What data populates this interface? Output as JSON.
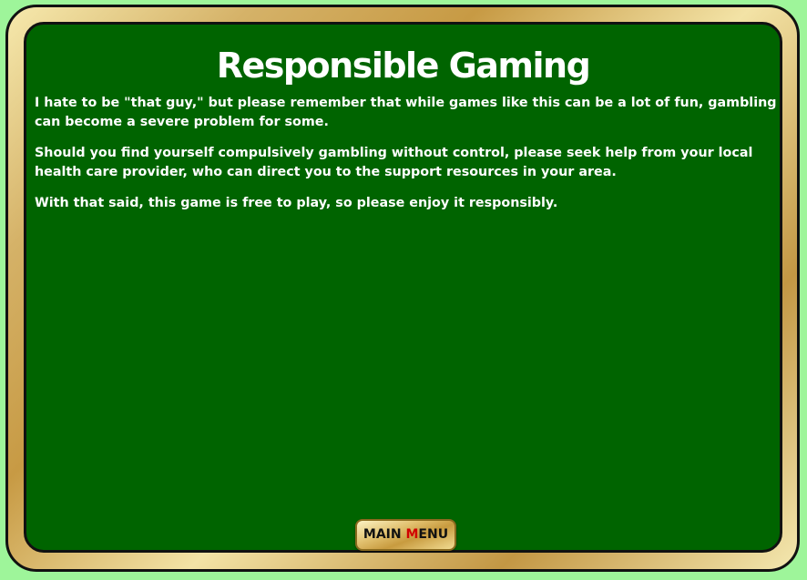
{
  "dialog": {
    "title": "Responsible Gaming",
    "paragraphs": [
      "I hate to be \"that guy,\" but please remember that while games like this can be a lot of fun, gambling can become a severe problem for some.",
      "Should you find yourself compulsively gambling without control, please seek help from your local health care provider, who can direct you to the support resources in your area.",
      "With that said, this game is free to play, so please enjoy it responsibly."
    ]
  },
  "main_menu_button": {
    "label_before": "MAIN ",
    "hotkey": "M",
    "label_after": "ENU"
  },
  "colors": {
    "page_background": "#9ef59a",
    "felt_green": "#006400",
    "gold_frame": "#c79a44",
    "text": "#ffffff",
    "hotkey": "#d10000"
  }
}
